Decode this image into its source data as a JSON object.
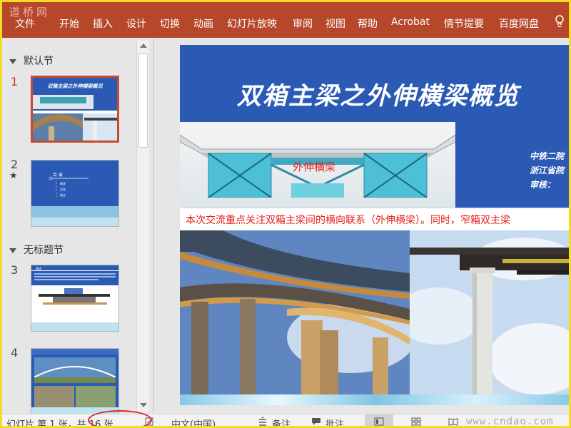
{
  "ribbon": {
    "watermark": "道桥网",
    "tabs": [
      "文件",
      "开始",
      "插入",
      "设计",
      "切换",
      "动画",
      "幻灯片放映",
      "审阅",
      "视图",
      "帮助",
      "Acrobat",
      "情节提要",
      "百度网盘"
    ],
    "tell_icon": "lightbulb-icon",
    "color": "#b7472a"
  },
  "sections": [
    {
      "name": "默认节"
    },
    {
      "name": "无标题节"
    }
  ],
  "thumbnails": [
    {
      "number": "1",
      "selected": true
    },
    {
      "number": "2",
      "star": "★"
    },
    {
      "number": "3"
    },
    {
      "number": "4"
    }
  ],
  "thumb1": {
    "title": "双箱主梁之外伸横梁概况"
  },
  "thumb2": {
    "heading": "目 录",
    "items": [
      "概述",
      "比较",
      "结论"
    ]
  },
  "thumb3": {
    "header": "概述"
  },
  "slide": {
    "title": "双箱主梁之外伸横梁概览",
    "bridge_label": "外伸横梁",
    "org_lines": [
      "中铁二院",
      "浙江省院",
      "审核："
    ],
    "banner_text": "本次交流重点关注双箱主梁间的横向联系（外伸横梁）。同时，窄箱双主梁"
  },
  "statusbar": {
    "slide_count": "幻灯片 第 1 张，共 16 张",
    "language": "中文(中国)",
    "notes": "备注",
    "comments": "批注",
    "watermark": "www.cndao.com"
  },
  "colors": {
    "accent": "#c74a2b",
    "slide_bg": "#2a5ab4",
    "highlight": "#e02323"
  }
}
